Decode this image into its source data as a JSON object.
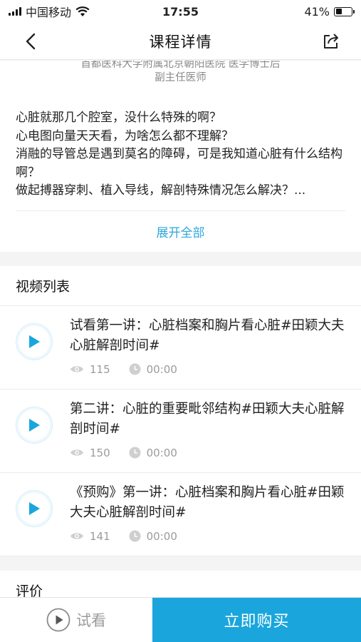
{
  "status_bar": {
    "carrier": "中国移动",
    "time": "17:55",
    "battery": "41%",
    "battery_level": 0.41
  },
  "nav": {
    "title": "课程详情"
  },
  "intro": {
    "doctor_line1": "首都医科大学附属北京朝阳医院  医学博士后",
    "doctor_line2": "副主任医师",
    "description": "心脏就那几个腔室，没什么特殊的啊？\n心电图向量天天看，为啥怎么都不理解？\n消融的导管总是遇到莫名的障碍，可是我知道心脏有什么结构啊？\n做起搏器穿刺、植入导线，解剖特殊情况怎么解决？...",
    "expand_label": "展开全部"
  },
  "video_list": {
    "title": "视频列表",
    "items": [
      {
        "title": "试看第一讲：心脏档案和胸片看心脏#田颖大夫心脏解剖时间#",
        "views": "115",
        "duration": "00:00"
      },
      {
        "title": "第二讲：心脏的重要毗邻结构#田颖大夫心脏解剖时间#",
        "views": "150",
        "duration": "00:00"
      },
      {
        "title": "《预购》第一讲：心脏档案和胸片看心脏#田颖大夫心脏解剖时间#",
        "views": "141",
        "duration": "00:00"
      }
    ]
  },
  "reviews": {
    "title": "评价"
  },
  "bottom_bar": {
    "trial_label": "试看",
    "buy_label": "立即购买"
  },
  "colors": {
    "accent": "#1aa6dc",
    "link": "#2fa7dc",
    "muted": "#9b9b9b"
  }
}
